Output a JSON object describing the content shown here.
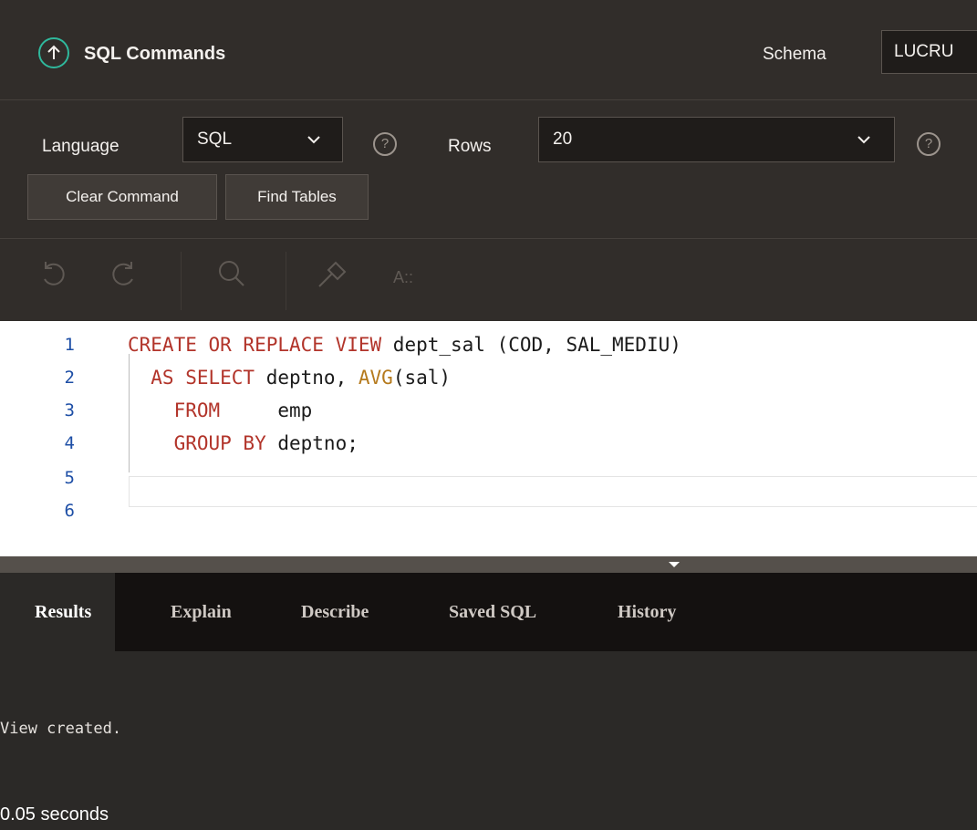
{
  "header": {
    "title": "SQL Commands",
    "schema_label": "Schema",
    "schema_value": "LUCRU"
  },
  "controls": {
    "language_label": "Language",
    "language_value": "SQL",
    "rows_label": "Rows",
    "rows_value": "20",
    "help_glyph": "?",
    "clear_button": "Clear Command",
    "find_button": "Find Tables"
  },
  "editor_toolbar": {
    "icons": [
      "undo-icon",
      "redo-icon",
      "search-icon",
      "format-icon",
      "autocomplete-icon"
    ],
    "autocomplete_text": "A::"
  },
  "editor": {
    "line_numbers": [
      "1",
      "2",
      "3",
      "4",
      "5",
      "6"
    ],
    "lines": [
      [
        {
          "t": "CREATE OR REPLACE VIEW",
          "k": "kw"
        },
        {
          "t": " dept_sal (COD, SAL_MEDIU)",
          "k": "id"
        }
      ],
      [
        {
          "t": "  AS SELECT",
          "k": "kw"
        },
        {
          "t": " deptno, ",
          "k": "id"
        },
        {
          "t": "AVG",
          "k": "fn"
        },
        {
          "t": "(sal)",
          "k": "id"
        }
      ],
      [
        {
          "t": "    FROM",
          "k": "kw"
        },
        {
          "t": "     emp",
          "k": "id"
        }
      ],
      [
        {
          "t": "    GROUP BY",
          "k": "kw"
        },
        {
          "t": " deptno;",
          "k": "id"
        }
      ],
      [],
      []
    ]
  },
  "tabs": [
    {
      "label": "Results",
      "active": true
    },
    {
      "label": "Explain",
      "active": false
    },
    {
      "label": "Describe",
      "active": false
    },
    {
      "label": "Saved SQL",
      "active": false
    },
    {
      "label": "History",
      "active": false
    }
  ],
  "results": {
    "message": "View created.",
    "timing": "0.05 seconds"
  },
  "colors": {
    "accent": "#2fb89c",
    "keyword": "#b2342a",
    "function": "#b57a1d",
    "line_number": "#1e4fa6"
  }
}
